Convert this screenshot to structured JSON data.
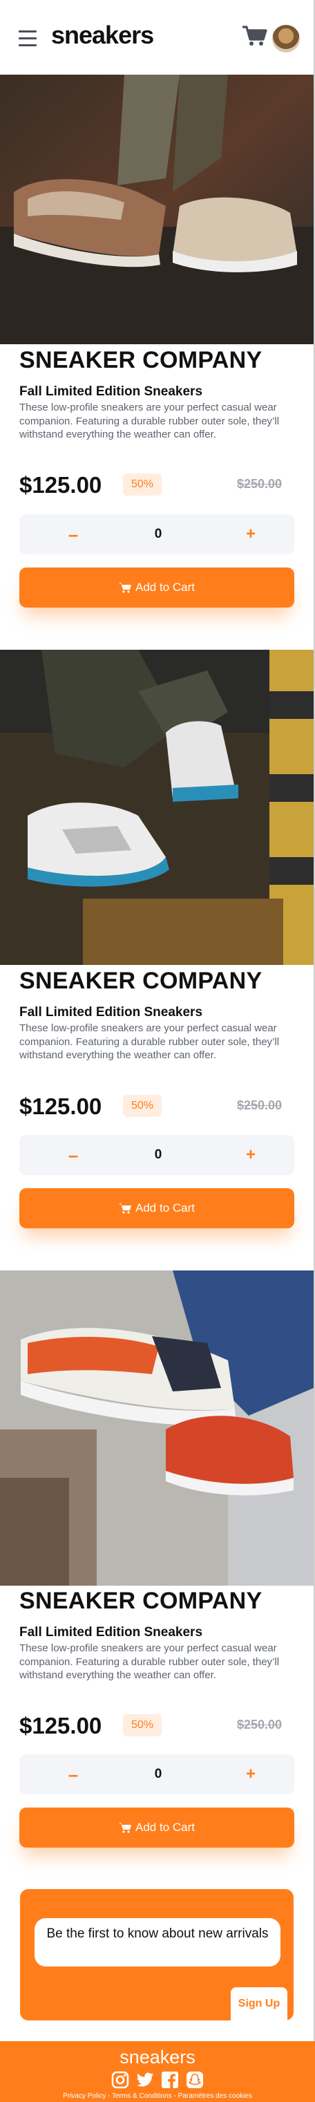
{
  "header": {
    "logo": "sneakers",
    "menu_icon": "hamburger-menu-icon",
    "cart_icon": "cart-icon",
    "avatar_icon": "user-avatar"
  },
  "products": [
    {
      "brand": "SNEAKER COMPANY",
      "title": "Fall Limited Edition Sneakers",
      "description": "These low-profile sneakers are your perfect casual wear companion. Featuring a durable rubber outer sole, they’ll withstand everything the weather can offer.",
      "price": "$125.00",
      "discount": "50%",
      "old_price": "$250.00",
      "quantity": "0",
      "minus": "–",
      "plus": "+",
      "add_to_cart": "Add to Cart"
    },
    {
      "brand": "SNEAKER COMPANY",
      "title": "Fall Limited Edition Sneakers",
      "description": "These low-profile sneakers are your perfect casual wear companion. Featuring a durable rubber outer sole, they’ll withstand everything the weather can offer.",
      "price": "$125.00",
      "discount": "50%",
      "old_price": "$250.00",
      "quantity": "0",
      "minus": "–",
      "plus": "+",
      "add_to_cart": "Add to Cart"
    },
    {
      "brand": "SNEAKER COMPANY",
      "title": "Fall Limited Edition Sneakers",
      "description": "These low-profile sneakers are your perfect casual wear companion. Featuring a durable rubber outer sole, they’ll withstand everything the weather can offer.",
      "price": "$125.00",
      "discount": "50%",
      "old_price": "$250.00",
      "quantity": "0",
      "minus": "–",
      "plus": "+",
      "add_to_cart": "Add to Cart"
    }
  ],
  "newsletter": {
    "text": "Be the first to know about new arrivals",
    "signup": "Sign Up"
  },
  "footer": {
    "logo": "sneakers",
    "links": [
      "Privacy Policy",
      "Terms & Conditions",
      "Paramètres des cookies"
    ],
    "separator": " - ",
    "social_icons": [
      "instagram-icon",
      "twitter-icon",
      "facebook-icon",
      "snapchat-icon"
    ]
  },
  "colors": {
    "accent": "#ff7e1b",
    "accent_pale": "#ffede0",
    "text_dark": "#1d2026",
    "text_grey": "#5d636e",
    "strike_grey": "#a3a7ae"
  }
}
